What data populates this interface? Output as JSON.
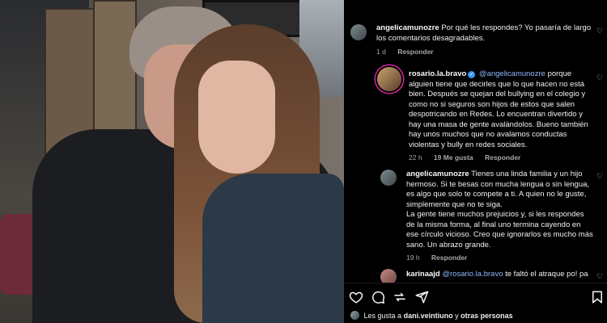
{
  "comments": [
    {
      "username": "angelicamunozre",
      "text": "Por qué les respondes? Yo pasaría de largo los comentarios desagradables.",
      "time": "1 d",
      "reply_label": "Responder"
    },
    {
      "username": "rosario.la.bravo",
      "mention": "@angelicamunozre",
      "text": "porque alguien tiene que decirles que lo que hacen no está bien. Después se quejan del bullying en el colegio y como no si seguros son hijos de estos que salen despotricando en Redes. Lo encuentran divertido y hay una masa de gente avalándolos. Bueno también hay unos muchos que no avalamos conductas violentas y bully en redes sociales.",
      "time": "22 h",
      "likes": "19 Me gusta",
      "reply_label": "Responder"
    },
    {
      "username": "angelicamunozre",
      "text": "Tienes una linda familia y un hijo hermoso. Si te besas con mucha lengua o sin lengua, es algo que solo te compete a ti. A quien no le guste, simplemente que no te siga.",
      "text2": "La gente tiene muchos prejuicios y, si les respondes de la misma forma, al final uno termina cayendo en ese círculo vicioso. Creo que ignorarlos es mucho más sano. Un abrazo grande.",
      "time": "19 h",
      "reply_label": "Responder"
    },
    {
      "username": "karinaajd",
      "mention": "@rosario.la.bravo",
      "text": "te faltó el atraque po! pa"
    }
  ],
  "likes_line": {
    "prefix": "Les gusta a",
    "user": "dani.veintiuno",
    "joiner": "y",
    "others": "otras personas"
  },
  "icons": [
    "heart-icon",
    "comment-icon",
    "share-icon",
    "send-icon",
    "bookmark-icon"
  ],
  "colors": {
    "mention": "#8fb7ff",
    "verified": "#3897f0",
    "story_ring": "#d6249f"
  }
}
